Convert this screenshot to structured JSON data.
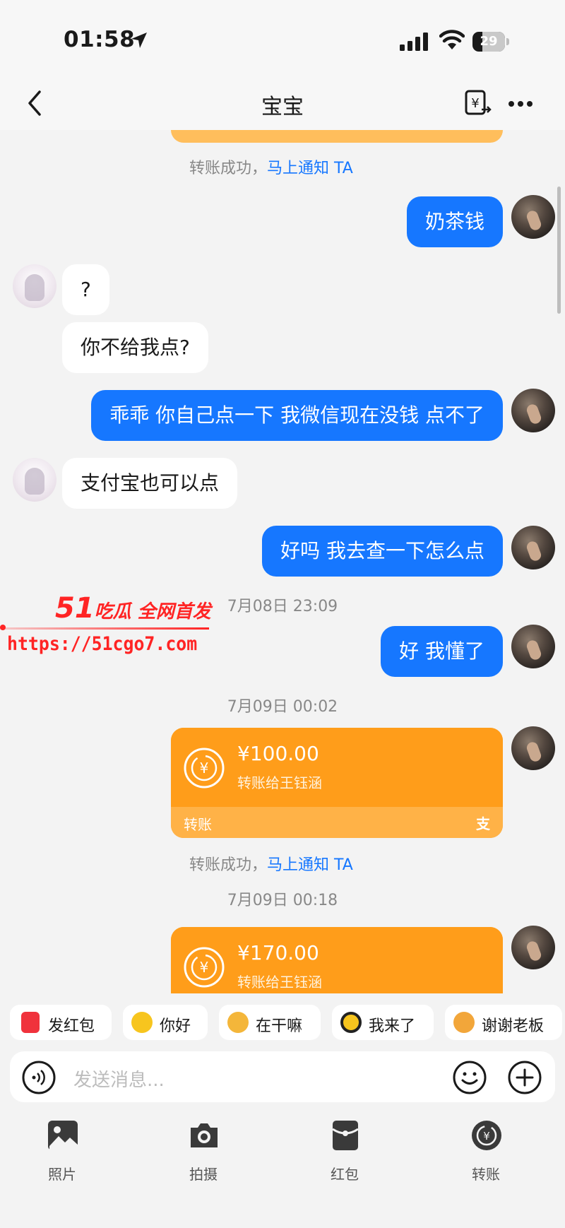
{
  "status_bar": {
    "time": "01:58",
    "battery": "29"
  },
  "header": {
    "title": "宝宝"
  },
  "messages": [
    {
      "from": "me",
      "text": "奶茶钱"
    },
    {
      "from": "her",
      "text": "?"
    },
    {
      "from": "her",
      "text": "你不给我点?"
    },
    {
      "from": "me",
      "text": "乖乖 你自己点一下 我微信现在没钱 点不了"
    },
    {
      "from": "her",
      "text": "支付宝也可以点"
    },
    {
      "from": "me",
      "text": "好吗 我去查一下怎么点"
    },
    {
      "from": "me",
      "text": "好 我懂了"
    }
  ],
  "notices": {
    "success_prefix": "转账成功，",
    "notify_link": "马上通知 TA"
  },
  "timestamps": [
    "7月08日 23:09",
    "7月09日 00:02",
    "7月09日 00:18"
  ],
  "transfers": [
    {
      "amount": "¥100.00",
      "desc": "转账给王钰涵",
      "label": "转账",
      "logo": "支"
    },
    {
      "amount": "¥170.00",
      "desc": "转账给王钰涵"
    }
  ],
  "watermark": {
    "number": "51",
    "brand": "吃瓜 全网首发",
    "url": "https://51cgo7.com"
  },
  "quick_replies": [
    "发红包",
    "你好",
    "在干嘛",
    "我来了",
    "谢谢老板"
  ],
  "input": {
    "placeholder": "发送消息..."
  },
  "toolbar": [
    "照片",
    "拍摄",
    "红包",
    "转账"
  ],
  "colors": {
    "accent_blue": "#1677ff",
    "transfer_orange": "#ff9d1a",
    "red_packet": "#f0323c"
  }
}
